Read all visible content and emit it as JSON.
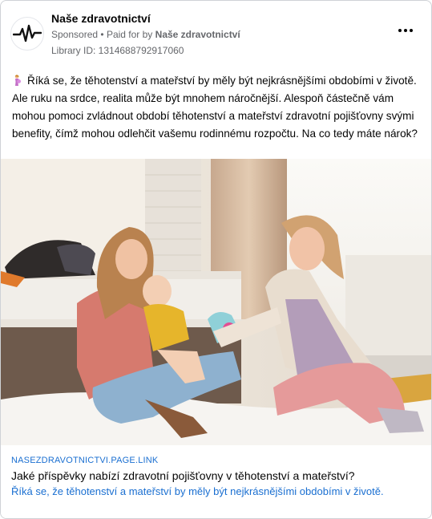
{
  "post": {
    "page_name": "Naše zdravotnictví",
    "sponsored": "Sponsored",
    "separator": "•",
    "paid_for_prefix": "Paid for by",
    "paid_for_name": "Naše zdravotnictví",
    "library_id": "Library ID: 1314688792917060",
    "body": "Říká se, že těhotenství a mateřství by měly být nejkrásnějšími obdobími v životě. Ale ruku na srdce, realita může být mnohem náročnější. Alespoň částečně vám mohou pomoci zvládnout období těhotenství a mateřství zdravotní pojišťovny svými benefity, čímž mohou odlehčit vašemu rodinnému rozpočtu. Na co tedy máte nárok?"
  },
  "link": {
    "domain": "NASEZDRAVOTNICTVI.PAGE.LINK",
    "headline": "Jaké příspěvky nabízí zdravotní pojišťovny v těhotenství a mateřství?",
    "description": "Říká se, že těhotenství a mateřství by měly být nejkrásnějšími obdobími v životě."
  },
  "icons": {
    "avatar": "heartbeat-logo-icon",
    "more": "more-options-icon",
    "emoji": "pregnant-woman-emoji-icon"
  },
  "colors": {
    "link_blue": "#1a6fd1",
    "secondary_text": "#65676b",
    "border": "#cfd2d6"
  }
}
